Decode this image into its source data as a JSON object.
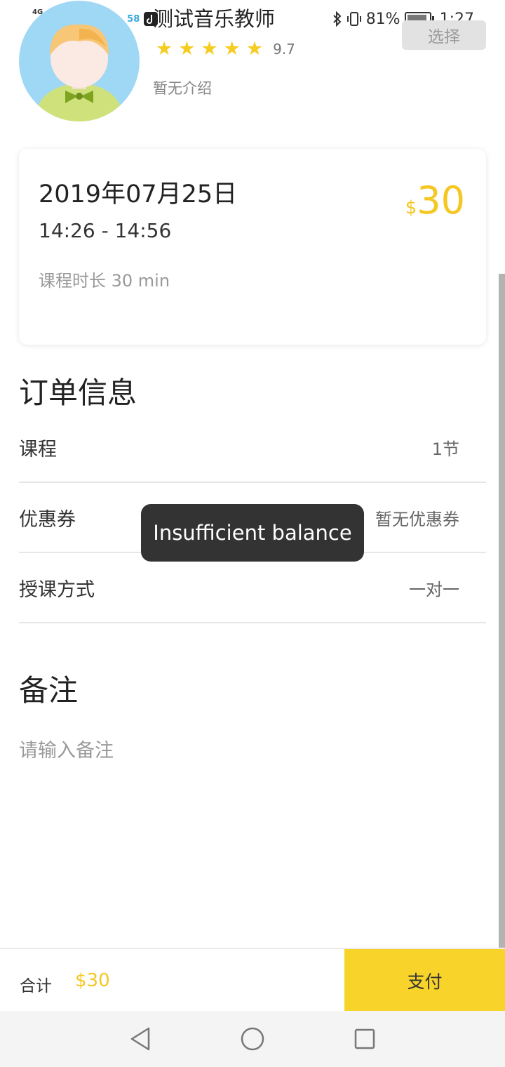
{
  "status_bar": {
    "network": "4G",
    "badge_58": "58",
    "battery_percent": "81%",
    "battery_level": 0.81,
    "time": "1:27"
  },
  "teacher": {
    "name": "测试音乐教师",
    "stars": 5,
    "score": "9.7",
    "intro": "暂无介绍",
    "select_label": "选择"
  },
  "lesson_card": {
    "date": "2019年07月25日",
    "time_range": "14:26 - 14:56",
    "duration": "课程时长 30 min",
    "currency": "$",
    "price": "30"
  },
  "order_info": {
    "title": "订单信息",
    "rows": [
      {
        "label": "课程",
        "value": "1节"
      },
      {
        "label": "优惠券",
        "value": "暂无优惠券"
      },
      {
        "label": "授课方式",
        "value": "一对一"
      }
    ]
  },
  "remarks": {
    "title": "备注",
    "placeholder": "请输入备注"
  },
  "toast": {
    "message": "Insufficient balance"
  },
  "footer": {
    "total_label": "合计",
    "total_value": "$30",
    "pay_label": "支付"
  },
  "icons": [
    "signal-icon",
    "wifi-icon",
    "brightness-icon",
    "squirrel-app-icon",
    "tiktok-app-icon",
    "bluetooth-icon",
    "vibrate-icon",
    "battery-icon",
    "star-icon",
    "back-nav-icon",
    "home-nav-icon",
    "recents-nav-icon"
  ],
  "colors": {
    "accent": "#f8d42b",
    "price": "#f5c722",
    "toast_bg": "#333333"
  }
}
